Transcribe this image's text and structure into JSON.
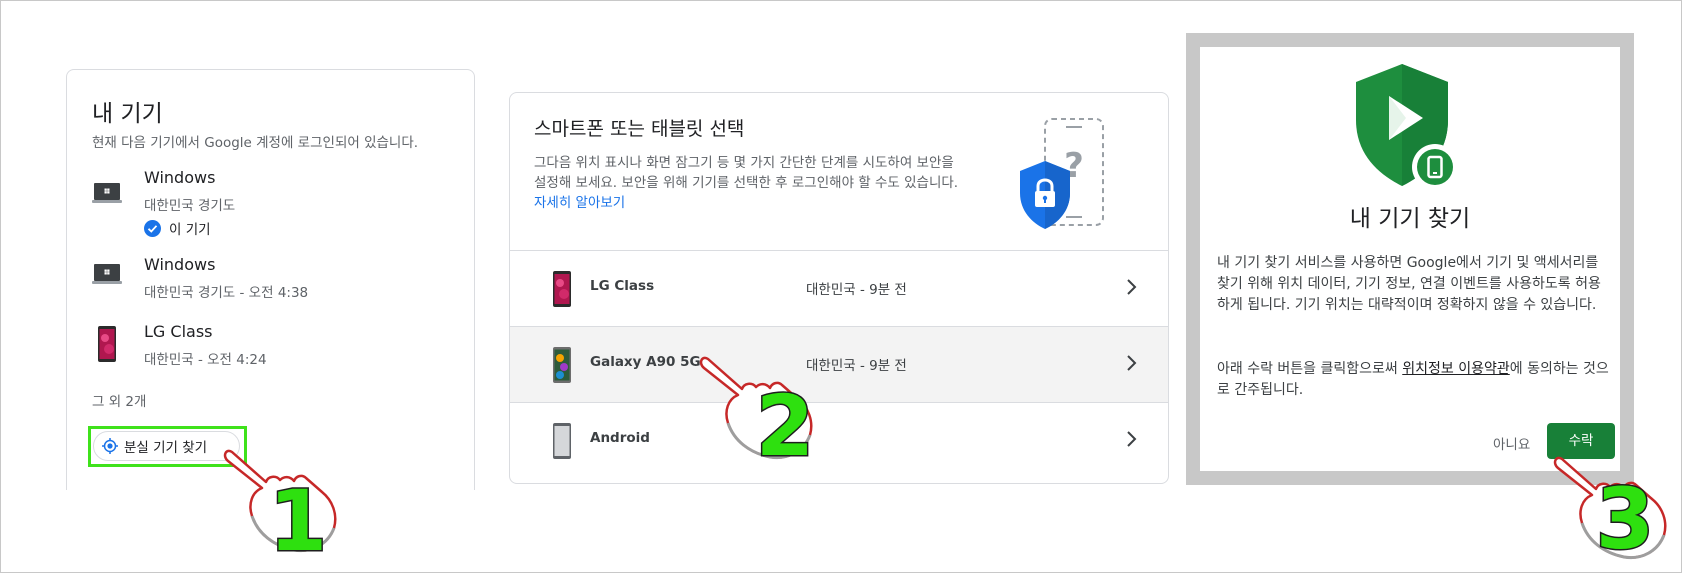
{
  "my_devices": {
    "title": "내 기기",
    "subtitle": "현재 다음 기기에서 Google 계정에 로그인되어 있습니다.",
    "devices": [
      {
        "name": "Windows",
        "location": "대한민국 경기도",
        "badge": "이 기기",
        "icon": "laptop-icon"
      },
      {
        "name": "Windows",
        "location": "대한민국 경기도 - 오전 4:38",
        "icon": "laptop-icon"
      },
      {
        "name": "LG Class",
        "location": "대한민국 - 오전 4:24",
        "icon": "phone-icon"
      }
    ],
    "more_label": "그 외 2개",
    "find_button_label": "분실 기기 찾기"
  },
  "select_device": {
    "title": "스마트폰 또는 태블릿 선택",
    "description": "그다음 위치 표시나 화면 잠그기 등 몇 가지 간단한 단계를 시도하여 보안을 설정해 보세요. 보안을 위해 기기를 선택한 후 로그인해야 할 수도 있습니다.",
    "learn_more": "자세히 알아보기",
    "devices": [
      {
        "name": "LG Class",
        "time": "대한민국 - 9분 전"
      },
      {
        "name": "Galaxy A90 5G",
        "time": "대한민국 - 9분 전"
      },
      {
        "name": "Android",
        "time": ""
      }
    ]
  },
  "find_my_device_dialog": {
    "title": "내 기기 찾기",
    "body": "내 기기 찾기 서비스를 사용하면 Google에서 기기 및 액세서리를 찾기 위해 위치 데이터, 기기 정보, 연결 이벤트를 사용하도록 허용하게 됩니다. 기기 위치는 대략적이며 정확하지 않을 수 있습니다.",
    "consent_prefix": "아래 수락 버튼을 클릭함으로써 ",
    "consent_link": "위치정보 이용약관",
    "consent_suffix": "에 동의하는 것으로 간주됩니다.",
    "decline_label": "아니요",
    "accept_label": "수락"
  },
  "step_markers": [
    "1",
    "2",
    "3"
  ],
  "colors": {
    "highlight": "#3fe21b",
    "accept": "#188038",
    "link": "#1a73e8",
    "shield": "#1e8e3e"
  }
}
